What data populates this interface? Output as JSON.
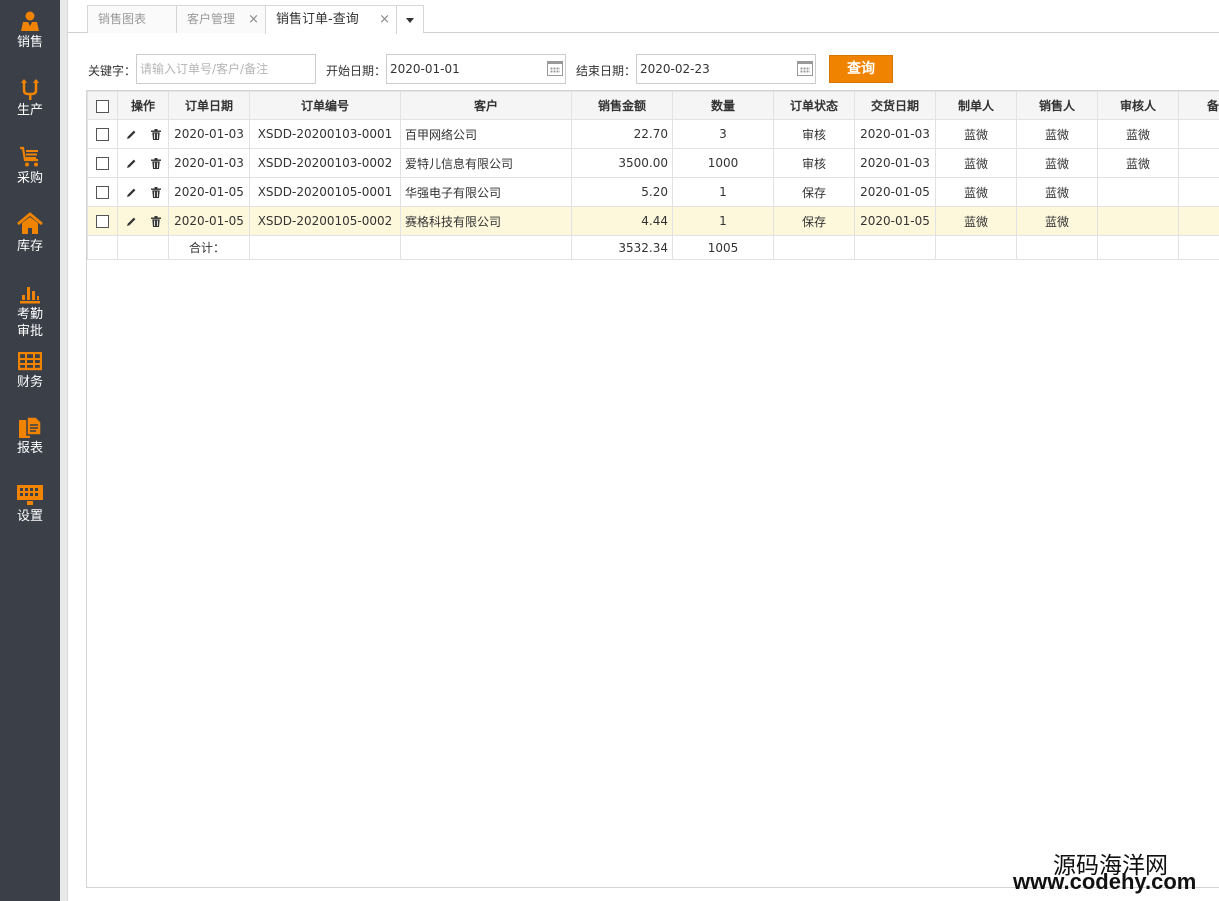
{
  "sidebar": {
    "items": [
      {
        "label": "销售",
        "icon": "sales-person-icon"
      },
      {
        "label": "生产",
        "icon": "production-arrows-icon"
      },
      {
        "label": "采购",
        "icon": "purchase-cart-icon"
      },
      {
        "label": "库存",
        "icon": "home-icon"
      },
      {
        "label": "考勤",
        "label2": "审批",
        "icon": "attendance-bars-icon"
      },
      {
        "label": "财务",
        "icon": "finance-grid-icon"
      },
      {
        "label": "报表",
        "icon": "report-doc-icon"
      },
      {
        "label": "设置",
        "icon": "settings-keyboard-icon"
      }
    ],
    "accent": "#f08300"
  },
  "tabs": [
    {
      "label": "销售图表",
      "active": false
    },
    {
      "label": "客户管理",
      "active": false
    },
    {
      "label": "销售订单-查询",
      "active": true
    }
  ],
  "filters": {
    "keyword_label": "关键字：",
    "keyword_placeholder": "请输入订单号/客户/备注",
    "start_label": "开始日期：",
    "start_value": "2020-01-01",
    "end_label": "结束日期：",
    "end_value": "2020-02-23",
    "query_button": "查询"
  },
  "table": {
    "headers": {
      "op": "操作",
      "date": "订单日期",
      "no": "订单编号",
      "customer": "客户",
      "amount": "销售金额",
      "qty": "数量",
      "status": "订单状态",
      "delivery": "交货日期",
      "creator": "制单人",
      "seller": "销售人",
      "auditor": "审核人",
      "more": "备"
    },
    "rows": [
      {
        "date": "2020-01-03",
        "no": "XSDD-20200103-0001",
        "customer": "百甲网络公司",
        "amount": "22.70",
        "qty": "3",
        "status": "审核",
        "delivery": "2020-01-03",
        "creator": "蓝微",
        "seller": "蓝微",
        "auditor": "蓝微"
      },
      {
        "date": "2020-01-03",
        "no": "XSDD-20200103-0002",
        "customer": "爱特儿信息有限公司",
        "amount": "3500.00",
        "qty": "1000",
        "status": "审核",
        "delivery": "2020-01-03",
        "creator": "蓝微",
        "seller": "蓝微",
        "auditor": "蓝微"
      },
      {
        "date": "2020-01-05",
        "no": "XSDD-20200105-0001",
        "customer": "华强电子有限公司",
        "amount": "5.20",
        "qty": "1",
        "status": "保存",
        "delivery": "2020-01-05",
        "creator": "蓝微",
        "seller": "蓝微",
        "auditor": ""
      },
      {
        "date": "2020-01-05",
        "no": "XSDD-20200105-0002",
        "customer": "赛格科技有限公司",
        "amount": "4.44",
        "qty": "1",
        "status": "保存",
        "delivery": "2020-01-05",
        "creator": "蓝微",
        "seller": "蓝微",
        "auditor": ""
      }
    ],
    "summary": {
      "label": "合计：",
      "amount": "3532.34",
      "qty": "1005"
    }
  },
  "watermark": {
    "line1": "源码海洋网",
    "line2": "www.codehy.com"
  }
}
